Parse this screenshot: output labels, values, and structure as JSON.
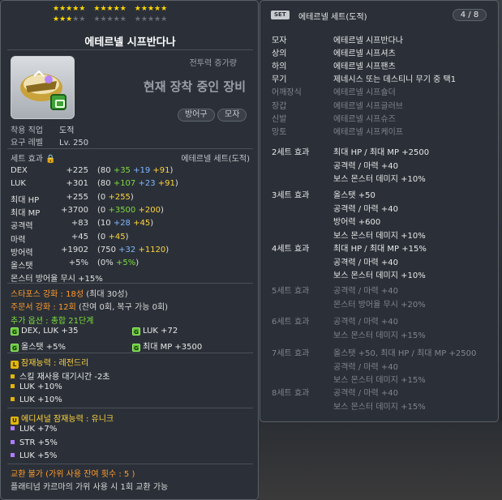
{
  "item": {
    "name": "에테르넬 시프반다나",
    "stars": {
      "filled": 18,
      "total": 30
    },
    "power_label": "전투력 증가량",
    "equipped_label": "현재 장착 중인 장비",
    "tags": [
      "방어구",
      "모자"
    ],
    "job_label": "착용 직업",
    "job_value": "도적",
    "level_label": "요구 레벨",
    "level_value": "Lv. 250"
  },
  "set_effect": {
    "label": "세트 효과",
    "set_name": "에테르넬 세트(도적)"
  },
  "stats": [
    {
      "name": "DEX",
      "total": "+225",
      "open": "(80 ",
      "parts": [
        {
          "t": "+35",
          "c": "green"
        },
        {
          "t": " +19",
          "c": "blue"
        },
        {
          "t": " +91",
          "c": "yellow"
        }
      ],
      "close": ")"
    },
    {
      "name": "LUK",
      "total": "+301",
      "open": "(80 ",
      "parts": [
        {
          "t": "+107",
          "c": "green"
        },
        {
          "t": " +23",
          "c": "blue"
        },
        {
          "t": " +91",
          "c": "yellow"
        }
      ],
      "close": ")"
    },
    {
      "name": "최대 HP",
      "total": "+255",
      "open": "(0 ",
      "parts": [
        {
          "t": "+255",
          "c": "yellow"
        }
      ],
      "close": ")"
    },
    {
      "name": "최대 MP",
      "total": "+3700",
      "open": "(0 ",
      "parts": [
        {
          "t": "+3500",
          "c": "green"
        },
        {
          "t": " +200",
          "c": "yellow"
        }
      ],
      "close": ")"
    },
    {
      "name": "공격력",
      "total": "+83",
      "open": "(10 ",
      "parts": [
        {
          "t": "+28",
          "c": "blue"
        },
        {
          "t": " +45",
          "c": "yellow"
        }
      ],
      "close": ")"
    },
    {
      "name": "마력",
      "total": "+45",
      "open": "(0 ",
      "parts": [
        {
          "t": "+45",
          "c": "yellow"
        }
      ],
      "close": ")"
    },
    {
      "name": "방어력",
      "total": "+1902",
      "open": "(750 ",
      "parts": [
        {
          "t": "+32",
          "c": "blue"
        },
        {
          "t": " +1120",
          "c": "yellow"
        }
      ],
      "close": ")"
    },
    {
      "name": "올스탯",
      "total": "+5%",
      "open": "(0% ",
      "parts": [
        {
          "t": "+5%",
          "c": "green"
        }
      ],
      "close": ")"
    },
    {
      "name": "몬스터 방어율 무시 +15%",
      "total": "",
      "open": "",
      "parts": [],
      "close": ""
    }
  ],
  "enhance": {
    "starforce": "스타포스 강화 : 18성",
    "starforce_max": "(최대 30성)",
    "scroll": "주문서 강화 : 12회",
    "scroll_detail": "(잔여 0회, 복구 가능 0회)",
    "additional": "추가 옵션 : 총합 21단계"
  },
  "add_options": [
    {
      "text": "DEX, LUK  +35"
    },
    {
      "text": "LUK  +72"
    },
    {
      "text": "올스탯  +5%"
    },
    {
      "text": "최대 MP  +3500"
    }
  ],
  "potential": {
    "badge": "L",
    "title": "잠재능력 : 레전드리",
    "lines": [
      "스킬 재사용 대기시간 -2초",
      "LUK +10%",
      "LUK +10%"
    ]
  },
  "additional_potential": {
    "badge": "U",
    "title": "에디셔널 잠재능력 : 유니크",
    "lines": [
      "LUK +7%",
      "STR +5%",
      "LUK +5%"
    ]
  },
  "trade": {
    "line1": "교환 불가 (가위 사용 잔여 횟수 : 5       )",
    "line2": "플래티넘 카르마의 가위 사용 시 1회 교환 가능"
  },
  "set_panel": {
    "badge": "SET",
    "title": "에테르넬 세트(도적)",
    "count": "4 / 8",
    "parts": [
      {
        "slot": "모자",
        "name": "에테르넬 시프반다나",
        "on": true
      },
      {
        "slot": "상의",
        "name": "에테르넬 시프셔츠",
        "on": true
      },
      {
        "slot": "하의",
        "name": "에테르넬 시프팬츠",
        "on": true
      },
      {
        "slot": "무기",
        "name": "제네시스 또는 데스티니 무기 중 택1",
        "on": true
      },
      {
        "slot": "어깨장식",
        "name": "에테르넬 시프숄더",
        "on": false
      },
      {
        "slot": "장갑",
        "name": "에테르넬 시프글러브",
        "on": false
      },
      {
        "slot": "신발",
        "name": "에테르넬 시프슈즈",
        "on": false
      },
      {
        "slot": "망토",
        "name": "에테르넬 시프케이프",
        "on": false
      }
    ],
    "bonuses": [
      {
        "label": "2세트 효과",
        "on": true,
        "lines": [
          "최대 HP / 최대 MP  +2500",
          "공격력 / 마력  +40",
          "보스 몬스터 데미지 +10%"
        ]
      },
      {
        "label": "3세트 효과",
        "on": true,
        "lines": [
          "올스탯  +50",
          "공격력 / 마력  +40",
          "방어력  +600",
          "보스 몬스터 데미지 +10%"
        ]
      },
      {
        "label": "4세트 효과",
        "on": true,
        "lines": [
          "최대 HP / 최대 MP  +15%",
          "공격력 / 마력  +40",
          "보스 몬스터 데미지 +10%"
        ]
      },
      {
        "label": "5세트 효과",
        "on": false,
        "lines": [
          "공격력 / 마력  +40",
          "몬스터 방어율 무시 +20%"
        ]
      },
      {
        "label": "6세트 효과",
        "on": false,
        "lines": [
          "공격력 / 마력  +40",
          "보스 몬스터 데미지 +15%"
        ]
      },
      {
        "label": "7세트 효과",
        "on": false,
        "lines": [
          "올스탯 +50, 최대 HP / 최대 MP  +2500",
          "공격력 / 마력  +40",
          "보스 몬스터 데미지 +15%"
        ]
      },
      {
        "label": "8세트 효과",
        "on": false,
        "lines": [
          "공격력 / 마력  +40",
          "보스 몬스터 데미지 +15%"
        ]
      }
    ]
  }
}
